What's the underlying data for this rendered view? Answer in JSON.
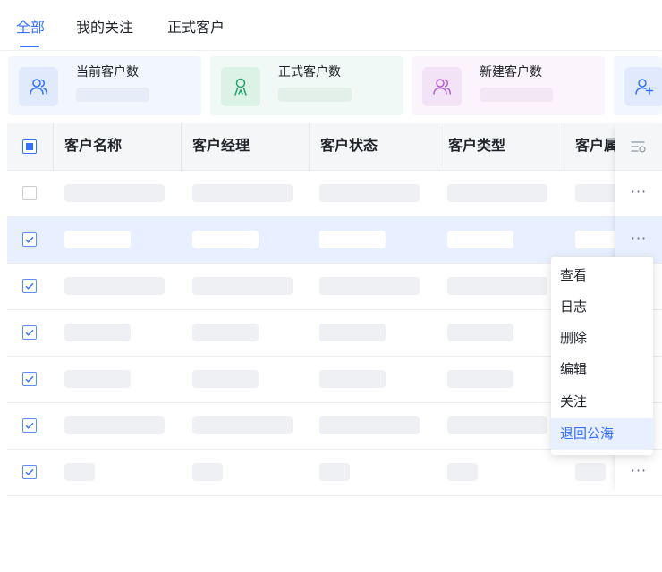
{
  "tabs": [
    {
      "label": "全部",
      "active": true
    },
    {
      "label": "我的关注",
      "active": false
    },
    {
      "label": "正式客户",
      "active": false
    }
  ],
  "stats": [
    {
      "label": "当前客户数",
      "icon": "users-icon",
      "color": "#3370ff",
      "bg": "#f2f6fe"
    },
    {
      "label": "正式客户数",
      "icon": "user-badge-icon",
      "color": "#23a26d",
      "bg": "#f0f9f5"
    },
    {
      "label": "新建客户数",
      "icon": "users-icon",
      "color": "#b55fd1",
      "bg": "#fbf4fc"
    },
    {
      "label": "",
      "icon": "user-add-icon",
      "color": "#3370ff",
      "bg": "#f2f6fe"
    }
  ],
  "table": {
    "columns": [
      "客户名称",
      "客户经理",
      "客户状态",
      "客户类型",
      "客户属"
    ],
    "rows": [
      {
        "checked": false,
        "selected": false
      },
      {
        "checked": true,
        "selected": true
      },
      {
        "checked": true,
        "selected": false
      },
      {
        "checked": true,
        "selected": false
      },
      {
        "checked": true,
        "selected": false
      },
      {
        "checked": true,
        "selected": false
      },
      {
        "checked": true,
        "selected": false
      }
    ],
    "more_label": "···"
  },
  "context_menu": {
    "items": [
      "查看",
      "日志",
      "删除",
      "编辑",
      "关注",
      "退回公海"
    ],
    "highlighted": "退回公海"
  },
  "colors": {
    "accent": "#3370ff",
    "selected_row": "#e8effe",
    "placeholder": "#eef0f3"
  }
}
